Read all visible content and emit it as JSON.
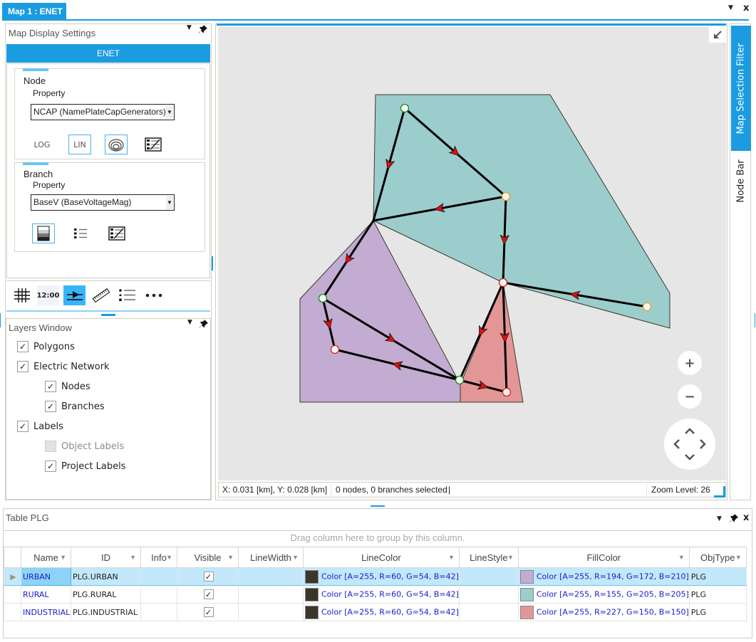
{
  "document": {
    "tab_title": "Map 1 : ENET",
    "menu_icon": "dropdown-arrow-icon",
    "close_label": "x"
  },
  "map_display_settings": {
    "title": "Map Display Settings",
    "network_tab": "ENET",
    "node": {
      "title": "Node",
      "property_label": "Property",
      "property_value": "NCAP (NamePlateCapGenerators)",
      "buttons": [
        "LOG",
        "LIN"
      ],
      "active": [
        "LIN",
        "size-rings"
      ]
    },
    "branch": {
      "title": "Branch",
      "property_label": "Property",
      "property_value": "BaseV (BaseVoltageMag)"
    },
    "toolbar": {
      "time_label": "12:00",
      "items": [
        "grid",
        "time",
        "flow-direction",
        "ruler",
        "legend",
        "more"
      ],
      "active": "flow-direction"
    }
  },
  "layers_window": {
    "title": "Layers Window",
    "items": [
      {
        "label": "Polygons",
        "checked": true,
        "enabled": true,
        "level": 0
      },
      {
        "label": "Electric Network",
        "checked": true,
        "enabled": true,
        "level": 0
      },
      {
        "label": "Nodes",
        "checked": true,
        "enabled": true,
        "level": 1
      },
      {
        "label": "Branches",
        "checked": true,
        "enabled": true,
        "level": 1
      },
      {
        "label": "Labels",
        "checked": true,
        "enabled": true,
        "level": 0
      },
      {
        "label": "Object Labels",
        "checked": false,
        "enabled": false,
        "level": 1
      },
      {
        "label": "Project Labels",
        "checked": true,
        "enabled": true,
        "level": 1
      }
    ]
  },
  "map": {
    "colors": {
      "background": "#e6e6e6",
      "urban": "#c2acd2",
      "rural": "#9bcdcd",
      "industrial": "#e39696",
      "polygon_line": "#3c362a",
      "branch": "#000000",
      "arrow": "#e01010"
    },
    "polygons": [
      {
        "name": "RURAL",
        "fill": "#9bcdcd"
      },
      {
        "name": "URBAN",
        "fill": "#c2acd2"
      },
      {
        "name": "INDUSTRIAL",
        "fill": "#e39696"
      }
    ],
    "node_status_colors": {
      "green": "#1a8a1a",
      "orange": "#f0a020",
      "red": "#e02020"
    },
    "controls": {
      "zoom_in": "+",
      "zoom_out": "−"
    }
  },
  "status_bar": {
    "coordinates": "X: 0.031 [km], Y: 0.028 [km]",
    "selection": "0 nodes, 0 branches selected",
    "cursor": "|",
    "zoom": "Zoom Level: 26"
  },
  "side_tabs": {
    "map_selection_filter": "Map Selection Filter",
    "node_bar": "Node Bar"
  },
  "table": {
    "title": "Table PLG",
    "group_hint": "Drag column here to group by this column.",
    "columns": [
      "Name",
      "ID",
      "Info",
      "Visible",
      "LineWidth",
      "LineColor",
      "LineStyle",
      "FillColor",
      "ObjType"
    ],
    "rows": [
      {
        "name": "URBAN",
        "id": "PLG.URBAN",
        "info": "",
        "visible": true,
        "line_width": "",
        "line_color": "Color [A=255, R=60, G=54, B=42]",
        "line_color_hex": "#3c362a",
        "line_style": "",
        "fill_color": "Color [A=255, R=194, G=172, B=210]",
        "fill_color_hex": "#c2acd2",
        "obj_type": "PLG",
        "selected": true
      },
      {
        "name": "RURAL",
        "id": "PLG.RURAL",
        "info": "",
        "visible": true,
        "line_width": "",
        "line_color": "Color [A=255, R=60, G=54, B=42]",
        "line_color_hex": "#3c362a",
        "line_style": "",
        "fill_color": "Color [A=255, R=155, G=205, B=205]",
        "fill_color_hex": "#9bcdcd",
        "obj_type": "PLG",
        "selected": false
      },
      {
        "name": "INDUSTRIAL",
        "id": "PLG.INDUSTRIAL",
        "info": "",
        "visible": true,
        "line_width": "",
        "line_color": "Color [A=255, R=60, G=54, B=42]",
        "line_color_hex": "#3c362a",
        "line_style": "",
        "fill_color": "Color [A=255, R=227, G=150, B=150]",
        "fill_color_hex": "#e39696",
        "obj_type": "PLG",
        "selected": false
      }
    ]
  }
}
